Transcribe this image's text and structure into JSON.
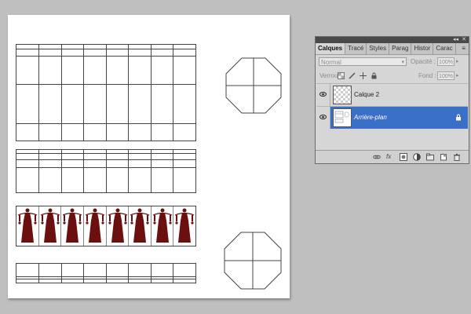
{
  "document": {
    "tables": [
      {
        "name": "table-top",
        "cols": 8,
        "rows": 4
      },
      {
        "name": "table-middle",
        "cols": 8,
        "rows": 4
      },
      {
        "name": "table-bottom",
        "cols": 8,
        "rows": 2
      }
    ],
    "figure_strip_cells": 8,
    "figure_color": "#6b0f0f"
  },
  "layers_panel": {
    "tabs": [
      "Calques",
      "Tracé",
      "Styles",
      "Parag",
      "Histor",
      "Carac"
    ],
    "active_tab": "Calques",
    "blend_mode": "Normal",
    "opacity_label": "Opacité :",
    "opacity_value": "100%",
    "lock_label": "Verrou :",
    "fill_label": "Fond :",
    "fill_value": "100%",
    "layers": [
      {
        "name": "Calque 2",
        "selected": false,
        "visible": true,
        "thumbnail": "transparent-checker"
      },
      {
        "name": "Arrière-plan",
        "selected": true,
        "visible": true,
        "thumbnail": "grid-drawing",
        "locked": true
      }
    ],
    "footer_icons": [
      "link-icon",
      "fx-icon",
      "mask-icon",
      "adjustment-icon",
      "group-folder-icon",
      "new-layer-icon",
      "trash-icon"
    ],
    "colors": {
      "selection": "#3a6fc8",
      "panel_bg": "#d6d6d6",
      "workspace": "#bfbfbf"
    }
  }
}
